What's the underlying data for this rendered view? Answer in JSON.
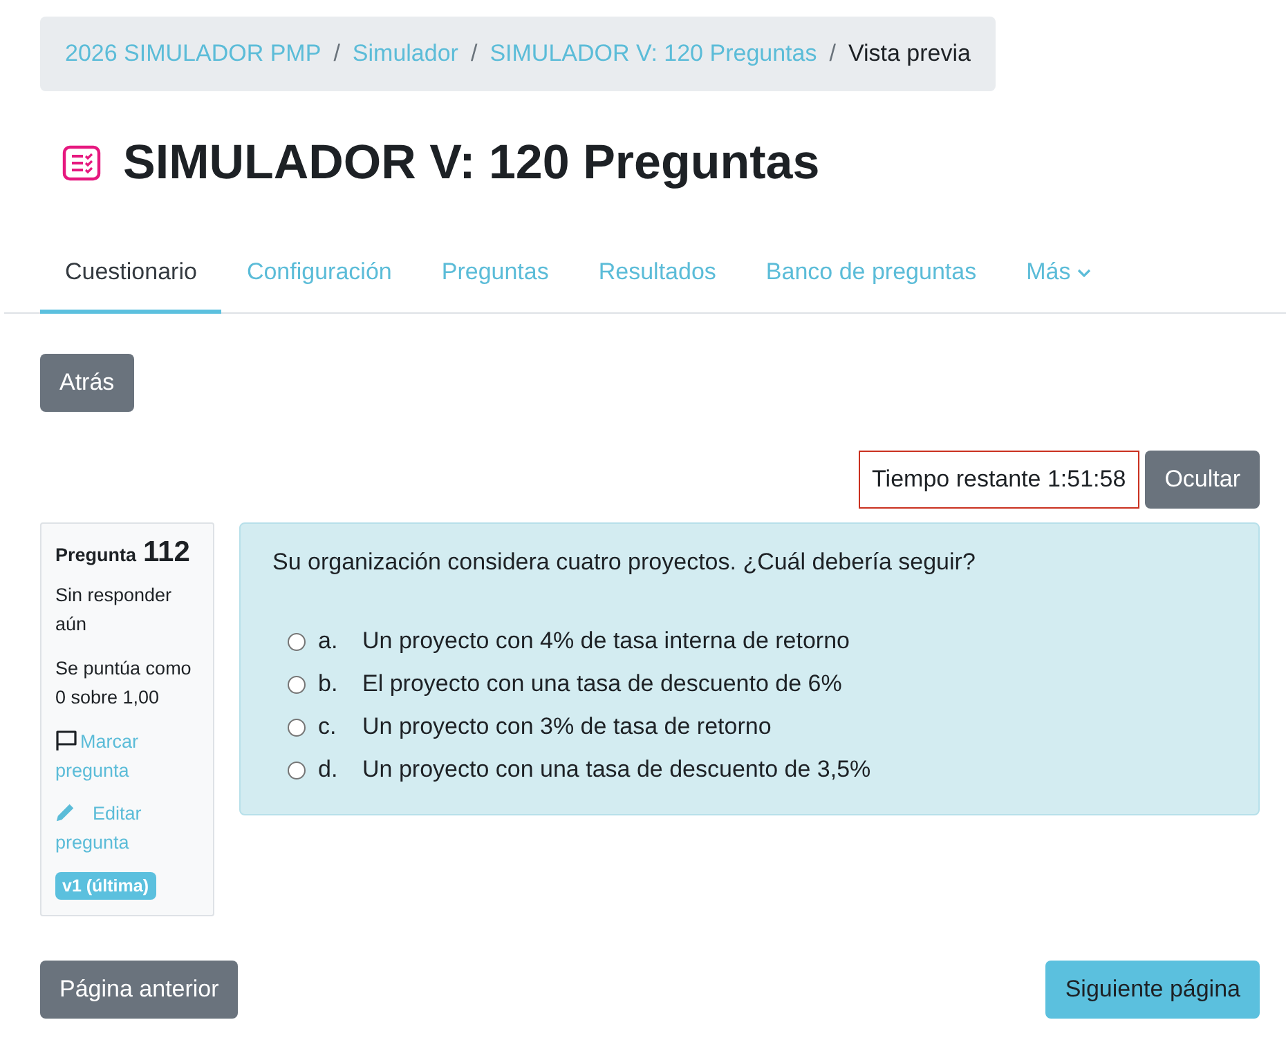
{
  "breadcrumb": [
    {
      "kind": "link",
      "label": "2026 SIMULADOR PMP"
    },
    {
      "kind": "separator",
      "label": "/"
    },
    {
      "kind": "link",
      "label": "Simulador"
    },
    {
      "kind": "separator",
      "label": "/"
    },
    {
      "kind": "link",
      "label": "SIMULADOR V: 120 Preguntas"
    },
    {
      "kind": "separator",
      "label": "/"
    },
    {
      "kind": "current",
      "label": "Vista previa"
    }
  ],
  "page_title": "SIMULADOR V: 120 Preguntas",
  "tabs": [
    {
      "label": "Cuestionario",
      "selected": true
    },
    {
      "label": "Configuración",
      "selected": false
    },
    {
      "label": "Preguntas",
      "selected": false
    },
    {
      "label": "Resultados",
      "selected": false
    },
    {
      "label": "Banco de preguntas",
      "selected": false
    },
    {
      "label": "Más",
      "selected": false,
      "kind": "menu"
    }
  ],
  "back_button": "Atrás",
  "timer": {
    "text": "Tiempo restante 1:51:58",
    "hide_button": "Ocultar"
  },
  "question_info": {
    "label": "Pregunta",
    "number": "112",
    "state": "Sin responder aún",
    "grade": "Se puntúa como 0 sobre 1,00",
    "flag_link": "Marcar pregunta",
    "flagged": false,
    "edit_link": "Editar pregunta",
    "version_badge": "v1 (última)"
  },
  "question": {
    "text": "Su organización considera cuatro proyectos. ¿Cuál debería seguir?",
    "options": [
      {
        "letter": "a.",
        "text": "Un proyecto con 4% de tasa interna de retorno",
        "selected": false
      },
      {
        "letter": "b.",
        "text": "El proyecto con una tasa de descuento de 6%",
        "selected": false
      },
      {
        "letter": "c.",
        "text": "Un proyecto con 3% de tasa de retorno",
        "selected": false
      },
      {
        "letter": "d.",
        "text": "Un proyecto con una tasa de descuento de 3,5%",
        "selected": false
      }
    ]
  },
  "navigation": {
    "previous": "Página anterior",
    "next": "Siguiente página"
  }
}
